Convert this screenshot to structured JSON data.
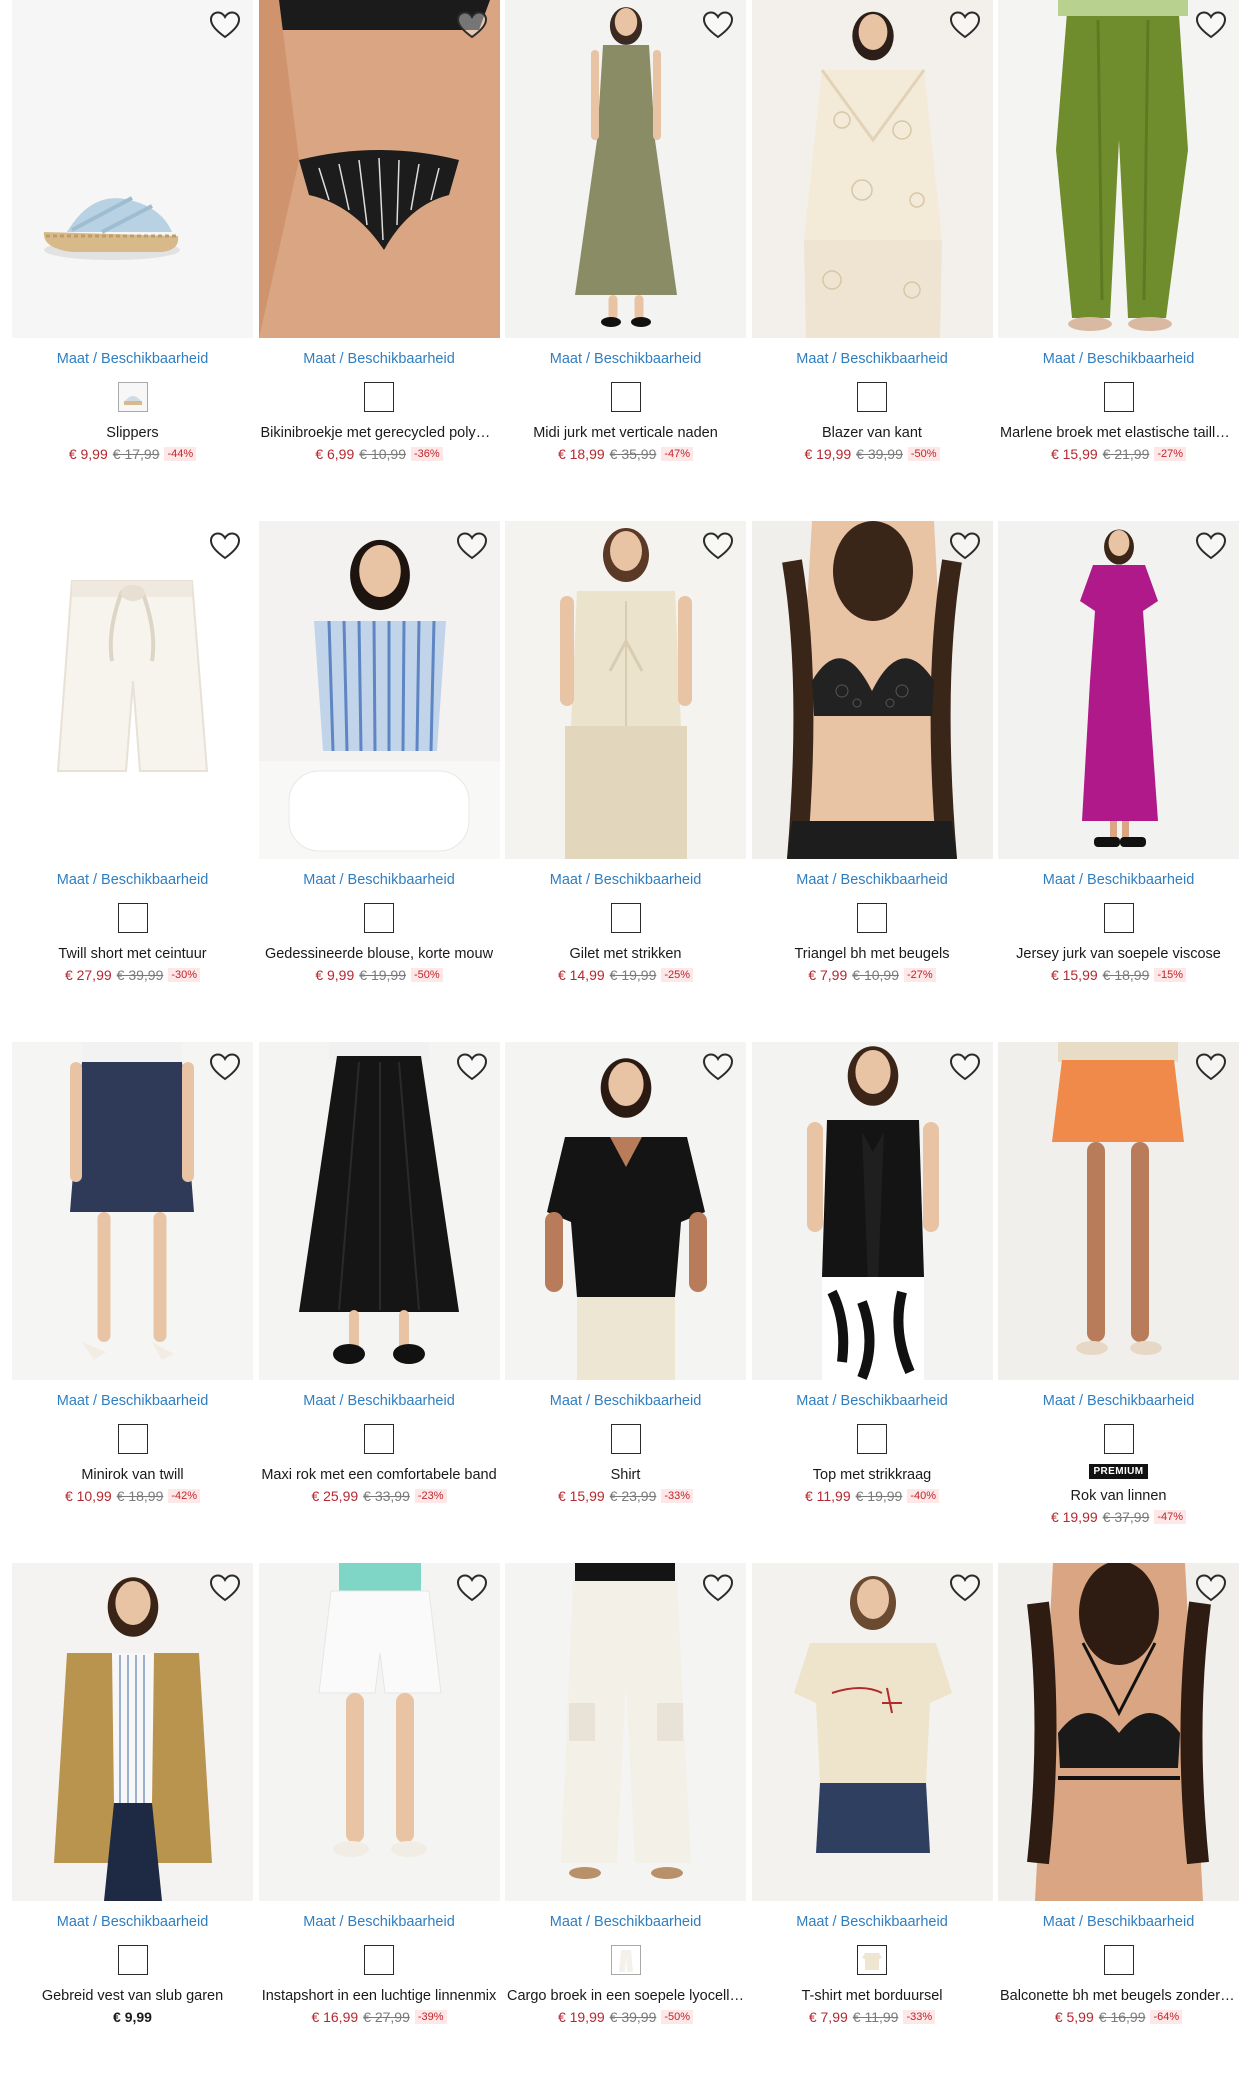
{
  "colors": {
    "link": "#2f7ec1",
    "sale_price": "#b4282f",
    "discount_bg": "#fde7e7",
    "discount_text": "#c0262d"
  },
  "products": [
    {
      "image": "slippers",
      "name": "Slippers",
      "price": "€ 9,99",
      "old_price": "€ 17,99",
      "discount": "-44%",
      "maat": "Maat / Beschikbaarheid",
      "swatch": "#cfdbe6",
      "swatch_type": "thin",
      "badge": ""
    },
    {
      "image": "bikini-bottom",
      "name": "Bikinibroekje met gerecycled polya…",
      "price": "€ 6,99",
      "old_price": "€ 10,99",
      "discount": "-36%",
      "maat": "Maat / Beschikbaarheid",
      "swatch": "#ffffff",
      "swatch_type": "plain",
      "badge": ""
    },
    {
      "image": "midi-dress",
      "name": "Midi jurk met verticale naden",
      "price": "€ 18,99",
      "old_price": "€ 35,99",
      "discount": "-47%",
      "maat": "Maat / Beschikbaarheid",
      "swatch": "#ffffff",
      "swatch_type": "plain",
      "badge": ""
    },
    {
      "image": "lace-blazer",
      "name": "Blazer van kant",
      "price": "€ 19,99",
      "old_price": "€ 39,99",
      "discount": "-50%",
      "maat": "Maat / Beschikbaarheid",
      "swatch": "#ffffff",
      "swatch_type": "plain",
      "badge": ""
    },
    {
      "image": "green-trousers",
      "name": "Marlene broek met elastische taille…",
      "price": "€ 15,99",
      "old_price": "€ 21,99",
      "discount": "-27%",
      "maat": "Maat / Beschikbaarheid",
      "swatch": "#ffffff",
      "swatch_type": "plain",
      "badge": ""
    },
    {
      "image": "white-shorts",
      "name": "Twill short met ceintuur",
      "price": "€ 27,99",
      "old_price": "€ 39,99",
      "discount": "-30%",
      "maat": "Maat / Beschikbaarheid",
      "swatch": "#ffffff",
      "swatch_type": "plain",
      "badge": ""
    },
    {
      "image": "striped-blouse",
      "name": "Gedessineerde blouse, korte mouw",
      "price": "€ 9,99",
      "old_price": "€ 19,99",
      "discount": "-50%",
      "maat": "Maat / Beschikbaarheid",
      "swatch": "#ffffff",
      "swatch_type": "plain",
      "badge": ""
    },
    {
      "image": "vest-top",
      "name": "Gilet met strikken",
      "price": "€ 14,99",
      "old_price": "€ 19,99",
      "discount": "-25%",
      "maat": "Maat / Beschikbaarheid",
      "swatch": "#ffffff",
      "swatch_type": "plain",
      "badge": ""
    },
    {
      "image": "lace-bra",
      "name": "Triangel bh met beugels",
      "price": "€ 7,99",
      "old_price": "€ 10,99",
      "discount": "-27%",
      "maat": "Maat / Beschikbaarheid",
      "swatch": "#ffffff",
      "swatch_type": "plain",
      "badge": ""
    },
    {
      "image": "magenta-dress",
      "name": "Jersey jurk van soepele viscose",
      "price": "€ 15,99",
      "old_price": "€ 18,99",
      "discount": "-15%",
      "maat": "Maat / Beschikbaarheid",
      "swatch": "#ffffff",
      "swatch_type": "plain",
      "badge": ""
    },
    {
      "image": "navy-skirt",
      "name": "Minirok van twill",
      "price": "€ 10,99",
      "old_price": "€ 18,99",
      "discount": "-42%",
      "maat": "Maat / Beschikbaarheid",
      "swatch": "#ffffff",
      "swatch_type": "plain",
      "badge": ""
    },
    {
      "image": "black-maxi-skirt",
      "name": "Maxi rok met een comfortabele band",
      "price": "€ 25,99",
      "old_price": "€ 33,99",
      "discount": "-23%",
      "maat": "Maat / Beschikbaarheid",
      "swatch": "#ffffff",
      "swatch_type": "plain",
      "badge": ""
    },
    {
      "image": "black-shirt",
      "name": "Shirt",
      "price": "€ 15,99",
      "old_price": "€ 23,99",
      "discount": "-33%",
      "maat": "Maat / Beschikbaarheid",
      "swatch": "#ffffff",
      "swatch_type": "plain",
      "badge": ""
    },
    {
      "image": "bow-top",
      "name": "Top met strikkraag",
      "price": "€ 11,99",
      "old_price": "€ 19,99",
      "discount": "-40%",
      "maat": "Maat / Beschikbaarheid",
      "swatch": "#ffffff",
      "swatch_type": "plain",
      "badge": ""
    },
    {
      "image": "orange-skirt",
      "name": "Rok van linnen",
      "price": "€ 19,99",
      "old_price": "€ 37,99",
      "discount": "-47%",
      "maat": "Maat / Beschikbaarheid",
      "swatch": "#ffffff",
      "swatch_type": "plain",
      "badge": "PREMIUM"
    },
    {
      "image": "cardigan",
      "name": "Gebreid vest van slub garen",
      "price": "€ 9,99",
      "old_price": "",
      "discount": "",
      "maat": "Maat / Beschikbaarheid",
      "swatch": "#ffffff",
      "swatch_type": "plain",
      "badge": ""
    },
    {
      "image": "linen-shorts",
      "name": "Instapshort in een luchtige linnenmix",
      "price": "€ 16,99",
      "old_price": "€ 27,99",
      "discount": "-39%",
      "maat": "Maat / Beschikbaarheid",
      "swatch": "#ffffff",
      "swatch_type": "plain",
      "badge": ""
    },
    {
      "image": "cargo-pants",
      "name": "Cargo broek in een soepele lyocell…",
      "price": "€ 19,99",
      "old_price": "€ 39,99",
      "discount": "-50%",
      "maat": "Maat / Beschikbaarheid",
      "swatch": "#f4f1ea",
      "swatch_type": "thin",
      "badge": ""
    },
    {
      "image": "embroidered-tshirt",
      "name": "T-shirt met borduursel",
      "price": "€ 7,99",
      "old_price": "€ 11,99",
      "discount": "-33%",
      "maat": "Maat / Beschikbaarheid",
      "swatch": "#efe6d2",
      "swatch_type": "plain",
      "badge": ""
    },
    {
      "image": "balconette-bra",
      "name": "Balconette bh met beugels zonder …",
      "price": "€ 5,99",
      "old_price": "€ 16,99",
      "discount": "-64%",
      "maat": "Maat / Beschikbaarheid",
      "swatch": "#ffffff",
      "swatch_type": "plain",
      "badge": ""
    }
  ]
}
